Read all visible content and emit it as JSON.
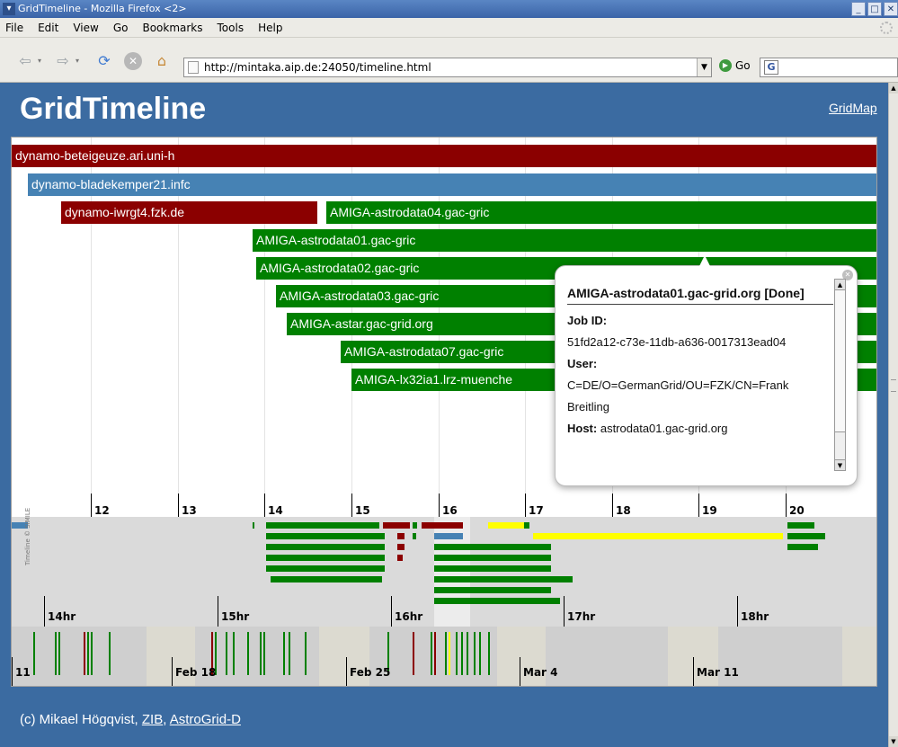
{
  "window": {
    "title": "GridTimeline - Mozilla Firefox <2>",
    "controls": [
      "minimize",
      "maximize",
      "close"
    ]
  },
  "menu": [
    "File",
    "Edit",
    "View",
    "Go",
    "Bookmarks",
    "Tools",
    "Help"
  ],
  "toolbar": {
    "url": "http://mintaka.aip.de:24050/timeline.html",
    "go_label": "Go"
  },
  "page": {
    "title": "GridTimeline",
    "gridmap_link": "GridMap",
    "footer": {
      "prefix": "(c) Mikael Högqvist, ",
      "link1": "ZIB",
      "sep": ", ",
      "link2": "AstroGrid-D"
    }
  },
  "timeline": {
    "colors": {
      "done": "#008000",
      "failed": "#8b0000",
      "running": "#4682b4",
      "pending": "#ffff00"
    },
    "events": [
      {
        "label": "dynamo-beteigeuze.ari.uni-h",
        "status": "failed"
      },
      {
        "label": "dynamo-bladekemper21.infc",
        "status": "running"
      },
      {
        "label": "dynamo-iwrgt4.fzk.de",
        "status": "failed"
      },
      {
        "label": "AMIGA-astrodata04.gac-gric",
        "status": "done"
      },
      {
        "label": "AMIGA-astrodata01.gac-gric",
        "status": "done"
      },
      {
        "label": "AMIGA-astrodata02.gac-gric",
        "status": "done"
      },
      {
        "label": "AMIGA-astrodata03.gac-gric",
        "status": "done"
      },
      {
        "label": "AMIGA-astar.gac-grid.org",
        "status": "done"
      },
      {
        "label": "AMIGA-astrodata07.gac-gric",
        "status": "done"
      },
      {
        "label": "AMIGA-lx32ia1.lrz-muenche",
        "status": "done"
      }
    ],
    "day_ticks": [
      "12",
      "13",
      "14",
      "15",
      "16",
      "17",
      "18",
      "19",
      "20"
    ],
    "hour_ticks": [
      "14hr",
      "15hr",
      "16hr",
      "17hr",
      "18hr"
    ],
    "week_ticks": [
      "11",
      "Feb 18",
      "Feb 25",
      "Mar 4",
      "Mar 11"
    ],
    "credit": "Timeline © SIMILE"
  },
  "bubble": {
    "title": "AMIGA-astrodata01.gac-grid.org [Done]",
    "job_id_label": "Job ID:",
    "job_id": "51fd2a12-c73e-11db-a636-0017313ead04",
    "user_label": "User:",
    "user": "C=DE/O=GermanGrid/OU=FZK/CN=Frank Breitling",
    "host_label": "Host:",
    "host": "astrodata01.gac-grid.org"
  }
}
